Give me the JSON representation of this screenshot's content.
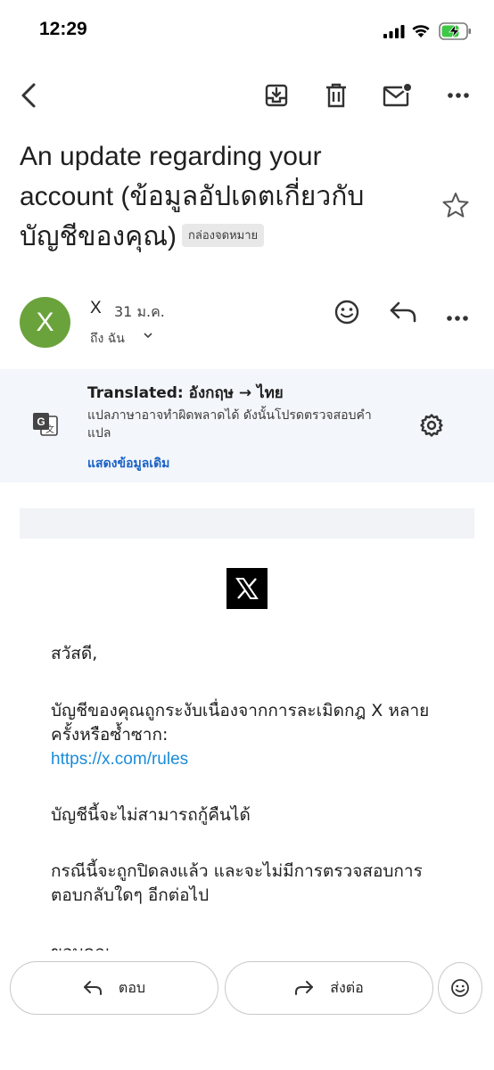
{
  "status_bar": {
    "time": "12:29"
  },
  "toolbar": {
    "back_icon": "back-arrow-icon",
    "archive_icon": "archive-icon",
    "delete_icon": "trash-icon",
    "unread_icon": "mark-unread-icon",
    "more_icon": "more-icon"
  },
  "email": {
    "subject_line1": "An update regarding your",
    "subject_line2": "account (ข้อมูลอัปเดตเกี่ยวกับ",
    "subject_line3": "บัญชีของคุณ)",
    "label": "กล่องจดหมาย",
    "sender_initial": "X",
    "sender_name": "X",
    "date": "31 ม.ค.",
    "to": "ถึง ฉัน",
    "avatar_color": "#6aa33b"
  },
  "translation": {
    "title": "Translated: อังกฤษ → ไทย",
    "description": "แปลภาษาอาจทำผิดพลาดได้ ดังนั้นโปรดตรวจสอบคำแปล",
    "show_original": "แสดงข้อมูลเดิม"
  },
  "body": {
    "greeting": "สวัสดี,",
    "para1": "บัญชีของคุณถูกระงับเนื่องจากการละเมิดกฎ X หลายครั้งหรือซ้ำซาก:",
    "rules_link": "https://x.com/rules",
    "para2": "บัญชีนี้จะไม่สามารถกู้คืนได้",
    "para3": "กรณีนี้จะถูกปิดลงแล้ว และจะไม่มีการตรวจสอบการตอบกลับใดๆ อีกต่อไป",
    "closing_partial": "ขอบคุณ"
  },
  "actions": {
    "reply_label": "ตอบ",
    "forward_label": "ส่งต่อ"
  }
}
